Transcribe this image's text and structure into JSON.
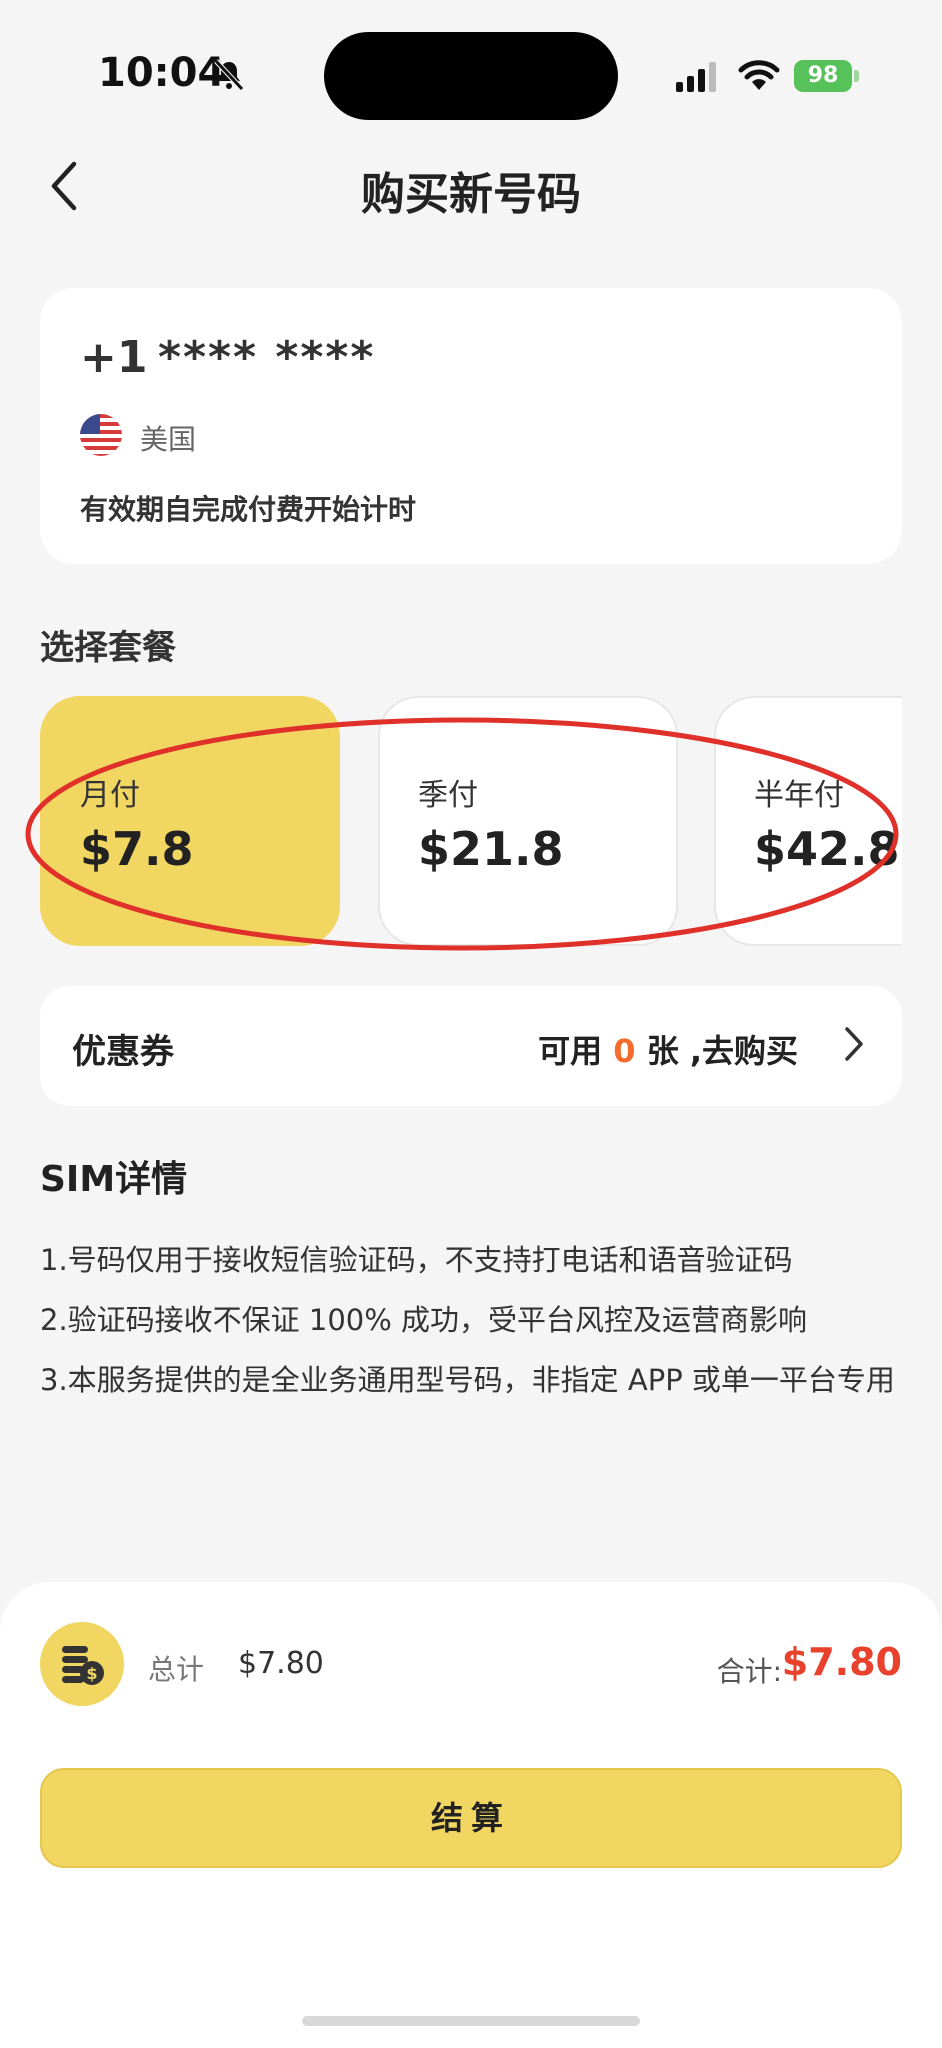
{
  "status_bar": {
    "time": "10:04",
    "battery": "98"
  },
  "header": {
    "title": "购买新号码"
  },
  "number_card": {
    "prefix": "+1",
    "masked_number": "**** ****",
    "country": "美国",
    "validity_note": "有效期自完成付费开始计时"
  },
  "plans": {
    "section_title": "选择套餐",
    "items": [
      {
        "name": "月付",
        "price": "$7.8",
        "selected": true
      },
      {
        "name": "季付",
        "price": "$21.8",
        "selected": false
      },
      {
        "name": "半年付",
        "price": "$42.8",
        "selected": false
      }
    ]
  },
  "coupon": {
    "label": "优惠券",
    "available_prefix": "可用 ",
    "count": "0",
    "available_suffix": " 张 ,去购买"
  },
  "sim_details": {
    "title": "SIM详情",
    "lines": [
      "1.号码仅用于接收短信验证码，不支持打电话和语音验证码",
      "2.验证码接收不保证 100% 成功，受平台风控及运营商影响",
      "3.本服务提供的是全业务通用型号码，非指定 APP 或单一平台专用"
    ]
  },
  "summary": {
    "total_label": "总计",
    "total_value": "$7.80",
    "sum_label": "合计:",
    "sum_value": "$7.80"
  },
  "checkout": {
    "label": "结算"
  },
  "colors": {
    "accent": "#f2d662",
    "price_red": "#e8412c",
    "coupon_orange": "#f36c2c",
    "annotation_red": "#e0302a"
  }
}
